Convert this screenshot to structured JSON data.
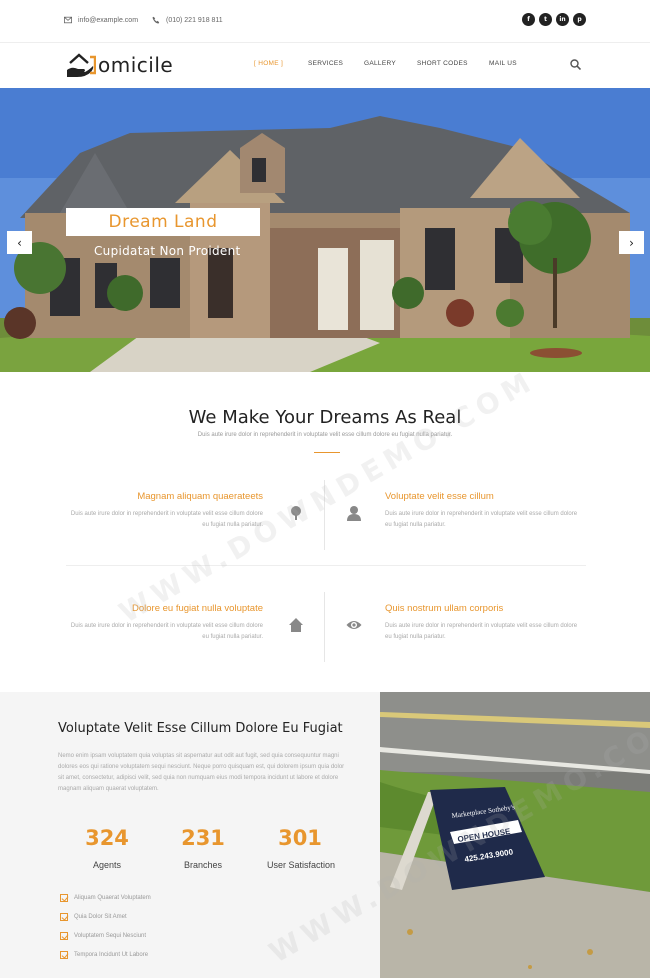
{
  "topbar": {
    "email": "info@example.com",
    "phone": "(010) 221 918 811",
    "social": [
      {
        "icon": "facebook-icon",
        "glyph": "f"
      },
      {
        "icon": "twitter-icon",
        "glyph": "t"
      },
      {
        "icon": "linkedin-icon",
        "glyph": "in"
      },
      {
        "icon": "pinterest-icon",
        "glyph": "p"
      }
    ]
  },
  "header": {
    "logo_text": "omicile",
    "nav": [
      "[ HOME ]",
      "SERVICES",
      "GALLERY",
      "SHORT CODES",
      "MAIL US"
    ]
  },
  "hero": {
    "title": "Dream Land",
    "subtitle": "Cupidatat Non Proident",
    "prev": "‹",
    "next": "›"
  },
  "features": {
    "title": "We Make Your Dreams As Real",
    "subtitle": "Duis aute irure dolor in reprehenderit in voluptate velit esse cillum dolore eu fugiat nulla pariatur.",
    "items": [
      {
        "title": "Magnam aliquam quaerateets",
        "text": "Duis aute irure dolor in reprehenderit in voluptate velit esse cillum dolore eu fugiat nulla pariatur.",
        "icon": "tree-icon"
      },
      {
        "title": "Voluptate velit esse cillum",
        "text": "Duis aute irure dolor in reprehenderit in voluptate velit esse cillum dolore eu fugiat nulla pariatur.",
        "icon": "user-icon"
      },
      {
        "title": "Dolore eu fugiat nulla voluptate",
        "text": "Duis aute irure dolor in reprehenderit in voluptate velit esse cillum dolore eu fugiat nulla pariatur.",
        "icon": "home-icon"
      },
      {
        "title": "Quis nostrum ullam corporis",
        "text": "Duis aute irure dolor in reprehenderit in voluptate velit esse cillum dolore eu fugiat nulla pariatur.",
        "icon": "eye-icon"
      }
    ]
  },
  "about": {
    "title": "Voluptate Velit Esse Cillum Dolore Eu Fugiat",
    "text": "Nemo enim ipsam voluptatem quia voluptas sit aspernatur aut odit aut fugit, sed quia consequuntur magni dolores eos qui ratione voluptatem sequi nesciunt. Neque porro quisquam est, qui dolorem ipsum quia dolor sit amet, consectetur, adipisci velit, sed quia non numquam eius modi tempora incidunt ut labore et dolore magnam aliquam quaerat voluptatem.",
    "stats": [
      {
        "value": "324",
        "label": "Agents"
      },
      {
        "value": "231",
        "label": "Branches"
      },
      {
        "value": "301",
        "label": "User Satisfaction"
      }
    ],
    "list": [
      "Aliquam Quaerat Voluptatem",
      "Quia Dolor Sit Amet",
      "Voluptatem Sequi Nesciunt",
      "Tempora Incidunt Ut Labore"
    ]
  },
  "sign": {
    "brand": "Marketplace Sotheby's",
    "open_house": "OPEN HOUSE",
    "phone": "425.243.9000"
  },
  "watermark": "WWW.DOWNDEMO.COM",
  "colors": {
    "accent": "#e8962e"
  }
}
